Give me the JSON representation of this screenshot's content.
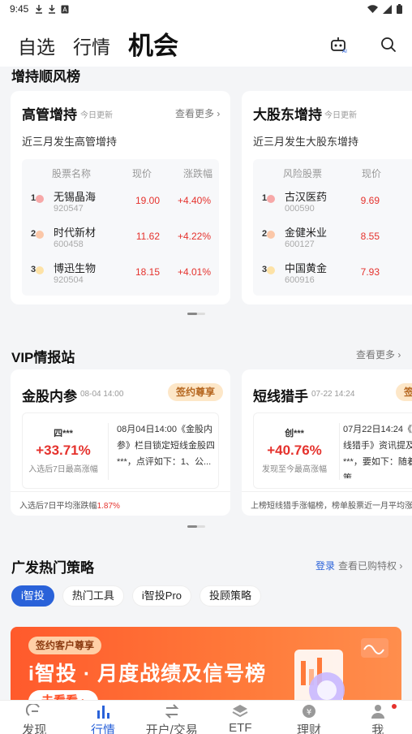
{
  "status": {
    "time": "9:45",
    "icons": [
      "download-icon",
      "download-icon",
      "a-icon"
    ],
    "right_icons": [
      "wifi-icon",
      "signal-icon",
      "battery-icon"
    ]
  },
  "header": {
    "tabs": [
      "自选",
      "行情",
      "机会"
    ],
    "active_tab": "机会",
    "icons": [
      "robot-ai-icon",
      "search-icon"
    ]
  },
  "hold_section": {
    "title": "增持顺风榜",
    "cards": [
      {
        "title": "高管增持",
        "update": "今日更新",
        "more": "查看更多",
        "subtitle": "近三月发生高管增持",
        "columns": [
          "股票名称",
          "现价",
          "涨跌幅"
        ],
        "rows": [
          {
            "rank": "1",
            "name": "无锡晶海",
            "code": "920547",
            "price": "19.00",
            "change": "+4.40%"
          },
          {
            "rank": "2",
            "name": "时代新材",
            "code": "600458",
            "price": "11.62",
            "change": "+4.22%"
          },
          {
            "rank": "3",
            "name": "博迅生物",
            "code": "920504",
            "price": "18.15",
            "change": "+4.01%"
          }
        ]
      },
      {
        "title": "大股东增持",
        "update": "今日更新",
        "more": "",
        "subtitle": "近三月发生大股东增持",
        "columns": [
          "风险股票",
          "现价"
        ],
        "rows": [
          {
            "rank": "1",
            "name": "古汉医药",
            "code": "000590",
            "price": "9.69"
          },
          {
            "rank": "2",
            "name": "金健米业",
            "code": "600127",
            "price": "8.55"
          },
          {
            "rank": "3",
            "name": "中国黄金",
            "code": "600916",
            "price": "7.93"
          }
        ]
      }
    ]
  },
  "vip_section": {
    "title": "VIP情报站",
    "more": "查看更多",
    "cards": [
      {
        "title": "金股内参",
        "time": "08-04 14:00",
        "badge": "签约尊享",
        "stock": "四***",
        "pct": "+33.71%",
        "note": "入选后7日最高涨幅",
        "text": "08月04日14:00《金股内参》栏目锁定短线金股四***，点评如下：1、公...",
        "foot": "入选后7日平均涨跌幅",
        "foot_value": "1.87%"
      },
      {
        "title": "短线猎手",
        "time": "07-22 14:24",
        "badge": "签",
        "stock": "创***",
        "pct": "+40.76%",
        "note": "发现至今最高涨幅",
        "text": "07月22日14:24《短线猎手》资讯提及创***，要如下：随着政策",
        "foot": "上榜短线猎手涨幅榜，榜单股票近一月平均涨幅"
      }
    ]
  },
  "strategy_section": {
    "title": "广发热门策略",
    "login": "登录",
    "view_rights": "查看已购特权",
    "chips": [
      "i智投",
      "热门工具",
      "i智投Pro",
      "投顾策略"
    ],
    "active_chip": "i智投"
  },
  "banner": {
    "tag": "签约客户尊享",
    "title": "i智投 · 月度战绩及信号榜",
    "button": "去看看 ›"
  },
  "bottom_nav": [
    {
      "label": "发现",
      "icon": "discover-icon"
    },
    {
      "label": "行情",
      "icon": "market-bars-icon"
    },
    {
      "label": "开户/交易",
      "icon": "transfer-icon"
    },
    {
      "label": "ETF",
      "icon": "layers-icon"
    },
    {
      "label": "理财",
      "icon": "coin-icon"
    },
    {
      "label": "我",
      "icon": "person-icon"
    }
  ],
  "colors": {
    "accent": "#2a62d9",
    "up": "#e5322d",
    "badge": "#fde7c8",
    "banner": "#ff5a2c"
  }
}
